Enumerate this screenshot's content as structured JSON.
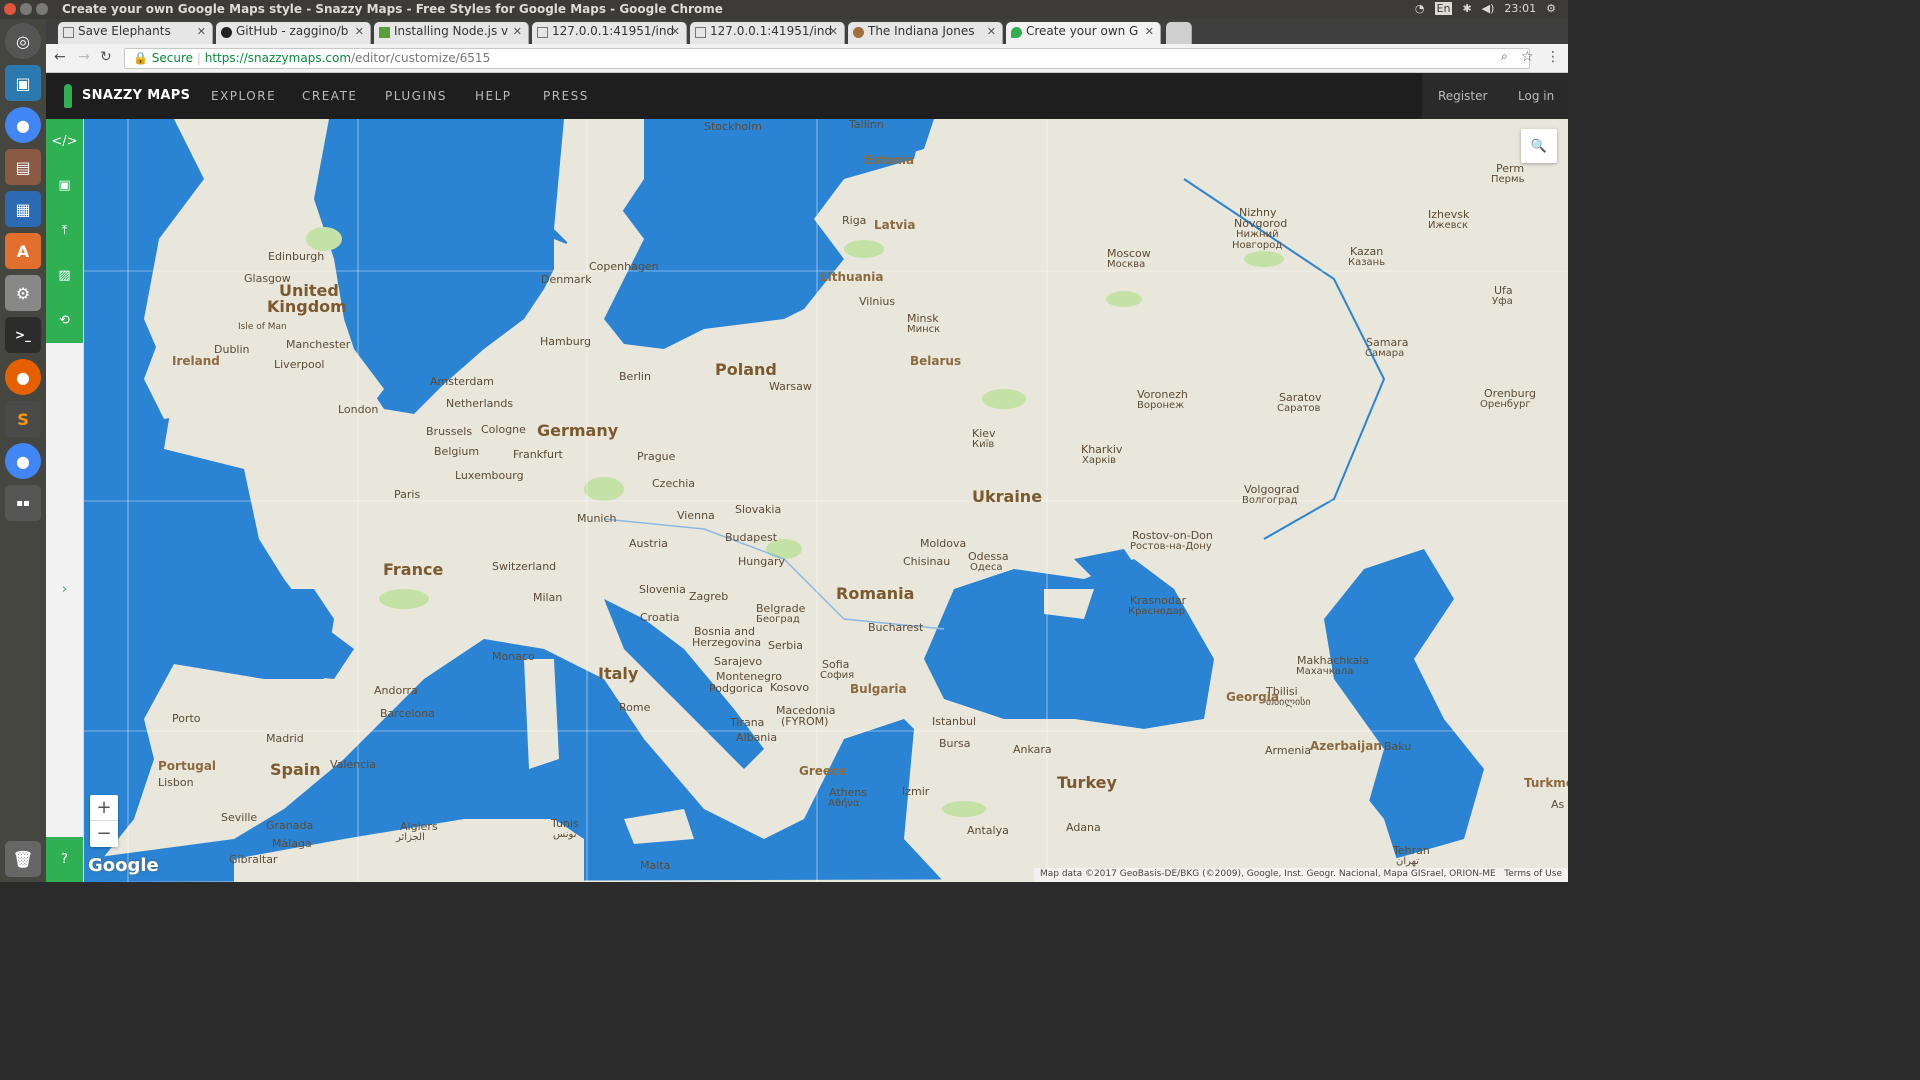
{
  "os": {
    "window_title": "Create your own Google Maps style - Snazzy Maps - Free Styles for Google Maps - Google Chrome",
    "keyboard": "En",
    "clock": "23:01"
  },
  "tabs": [
    {
      "label": "Save Elephants"
    },
    {
      "label": "GitHub - zaggino/b"
    },
    {
      "label": "Installing Node.js v"
    },
    {
      "label": "127.0.0.1:41951/ind"
    },
    {
      "label": "127.0.0.1:41951/ind"
    },
    {
      "label": "The Indiana Jones"
    },
    {
      "label": "Create your own G"
    }
  ],
  "address": {
    "secure_label": "Secure",
    "url_host": "https://snazzymaps.com",
    "url_path": "/editor/customize/6515"
  },
  "site": {
    "brand": "SNAZZY MAPS",
    "nav": [
      "EXPLORE",
      "CREATE",
      "PLUGINS",
      "HELP",
      "PRESS"
    ],
    "register": "Register",
    "login": "Log in"
  },
  "map": {
    "labels": {
      "stockholm": "Stockholm",
      "tallinn": "Tallinn",
      "estonia": "Estonia",
      "riga": "Riga",
      "latvia": "Latvia",
      "lithuania": "Lithuania",
      "vilnius": "Vilnius",
      "minsk": "Minsk",
      "minsk_ru": "Минск",
      "belarus": "Belarus",
      "moscow": "Moscow",
      "moscow_ru": "Москва",
      "nizhny": "Nizhny",
      "novgorod": "Novgorod",
      "nizhny_ru": "Нижний",
      "novgorod_ru": "Новгород",
      "izhevsk": "Izhevsk",
      "izhevsk_ru": "Ижевск",
      "perm": "Perm",
      "perm_ru": "Пермь",
      "kazan": "Kazan",
      "kazan_ru": "Казань",
      "ufa": "Ufa",
      "ufa_ru": "Уфа",
      "samara": "Samara",
      "samara_ru": "Самара",
      "orenburg": "Orenburg",
      "orenburg_ru": "Оренбург",
      "saratov": "Saratov",
      "saratov_ru": "Саратов",
      "voronezh": "Voronezh",
      "voronezh_ru": "Воронеж",
      "kharkiv": "Kharkiv",
      "kharkiv_ru": "Харків",
      "kiev": "Kiev",
      "kiev_ua": "Київ",
      "ukraine": "Ukraine",
      "volgograd": "Volgograd",
      "volgograd_ru": "Волгоград",
      "rostov": "Rostov-on-Don",
      "rostov_ru": "Ростов-на-Дону",
      "krasnodar": "Krasnodar",
      "krasnodar_ru": "Краснодар",
      "makhachkala": "Makhachkala",
      "makhachkala_ru": "Махачкала",
      "tbilisi": "Tbilisi",
      "tbilisi_ka": "თბილისი",
      "georgia": "Georgia",
      "armenia": "Armenia",
      "azerbaijan": "Azerbaijan",
      "baku": "Baku",
      "turkme": "Turkme",
      "as": "As",
      "tehran": "Tehran",
      "tehran_fa": "تهران",
      "turkey": "Turkey",
      "ankara": "Ankara",
      "istanbul": "Istanbul",
      "bursa": "Bursa",
      "izmir": "Izmir",
      "antalya": "Antalya",
      "adana": "Adana",
      "odessa": "Odessa",
      "odessa_ua": "Одеса",
      "chisinau": "Chisinau",
      "moldova": "Moldova",
      "romania": "Romania",
      "bucharest": "Bucharest",
      "bulgaria": "Bulgaria",
      "sofia": "Sofia",
      "sofia_bg": "София",
      "macedonia": "Macedonia",
      "fyrom": "(FYROM)",
      "kosovo": "Kosovo",
      "serbia": "Serbia",
      "belgrade": "Belgrade",
      "belgrade_sr": "Београд",
      "bosnia": "Bosnia and",
      "herzegovina": "Herzegovina",
      "sarajevo": "Sarajevo",
      "montenegro": "Montenegro",
      "podgorica": "Podgorica",
      "tirana": "Tirana",
      "albania": "Albania",
      "greece": "Greece",
      "athens": "Athens",
      "athens_gr": "Αθήνα",
      "croatia": "Croatia",
      "zagreb": "Zagreb",
      "slovenia": "Slovenia",
      "hungary": "Hungary",
      "budapest": "Budapest",
      "slovakia": "Slovakia",
      "vienna": "Vienna",
      "austria": "Austria",
      "czechia": "Czechia",
      "prague": "Prague",
      "poland": "Poland",
      "warsaw": "Warsaw",
      "berlin": "Berlin",
      "hamburg": "Hamburg",
      "germany": "Germany",
      "frankfurt": "Frankfurt",
      "munich": "Munich",
      "cologne": "Cologne",
      "copenhagen": "Copenhagen",
      "denmark": "Denmark",
      "amsterdam": "Amsterdam",
      "netherlands": "Netherlands",
      "brussels": "Brussels",
      "belgium": "Belgium",
      "luxembourg": "Luxembourg",
      "paris": "Paris",
      "france": "France",
      "switzerland": "Switzerland",
      "milan": "Milan",
      "monaco": "Monaco",
      "italy": "Italy",
      "rome": "Rome",
      "andorra": "Andorra",
      "barcelona": "Barcelona",
      "madrid": "Madrid",
      "spain": "Spain",
      "valencia": "Valencia",
      "portugal": "Portugal",
      "porto": "Porto",
      "lisbon": "Lisbon",
      "seville": "Seville",
      "granada": "Granada",
      "malaga": "Málaga",
      "gibraltar": "Gibraltar",
      "algiers": "Algiers",
      "algiers_ar": "الجزائر",
      "tunis": "Tunis",
      "tunis_ar": "تونس",
      "malta": "Malta",
      "london": "London",
      "manchester": "Manchester",
      "liverpool": "Liverpool",
      "isle_of_man": "Isle of Man",
      "edinburgh": "Edinburgh",
      "glasgow": "Glasgow",
      "united": "United",
      "kingdom": "Kingdom",
      "dublin": "Dublin",
      "ireland": "Ireland"
    },
    "attribution": "Map data ©2017 GeoBasis-DE/BKG (©2009), Google, Inst. Geogr. Nacional, Mapa GISrael, ORION-ME",
    "terms": "Terms of Use",
    "google_logo": "Google",
    "zoom_in": "+",
    "zoom_out": "−"
  },
  "colors": {
    "water": "#2a84d3",
    "land": "#e9e6dc",
    "green": "#c4e2a5",
    "accent": "#2fb153",
    "navbar": "#1e1e1e"
  }
}
